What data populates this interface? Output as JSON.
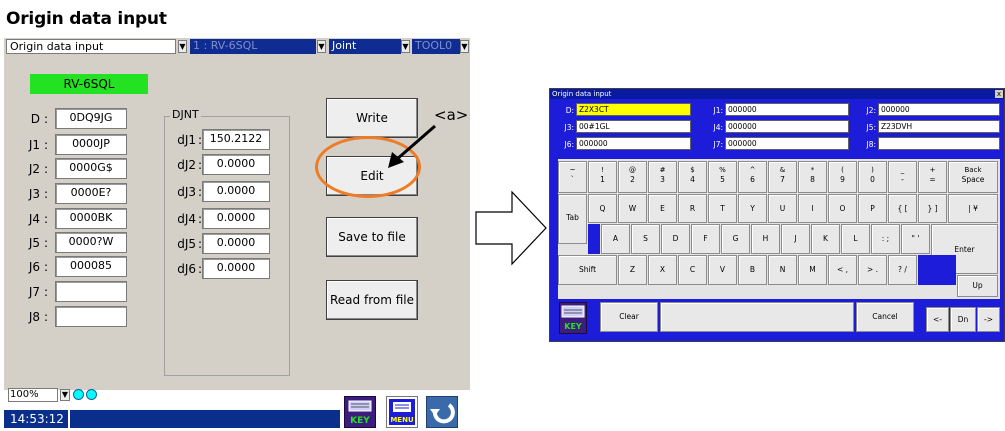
{
  "left": {
    "title": "Origin data input",
    "dropdowns": {
      "screen": "Origin data input",
      "robot": "1 : RV-6SQL",
      "joint": "Joint",
      "tool": "TOOL0"
    },
    "robot_model": "RV-6SQL",
    "axes": [
      {
        "label": "D",
        "value": "0DQ9JG"
      },
      {
        "label": "J1",
        "value": "0000JP"
      },
      {
        "label": "J2",
        "value": "0000G$"
      },
      {
        "label": "J3",
        "value": "0000E?"
      },
      {
        "label": "J4",
        "value": "0000BK"
      },
      {
        "label": "J5",
        "value": "0000?W"
      },
      {
        "label": "J6",
        "value": "000085"
      },
      {
        "label": "J7",
        "value": ""
      },
      {
        "label": "J8",
        "value": ""
      }
    ],
    "djnt": {
      "title": "DJNT",
      "rows": [
        {
          "label": "dJ1",
          "value": "150.2122"
        },
        {
          "label": "dJ2",
          "value": "0.0000"
        },
        {
          "label": "dJ3",
          "value": "0.0000"
        },
        {
          "label": "dJ4",
          "value": "0.0000"
        },
        {
          "label": "dJ5",
          "value": "0.0000"
        },
        {
          "label": "dJ6",
          "value": "0.0000"
        }
      ]
    },
    "buttons": {
      "write": "Write",
      "edit": "Edit",
      "save": "Save to file",
      "read": "Read from file"
    },
    "callout_label": "<a>",
    "zoom": "100%",
    "time": "14:53:12",
    "icons": {
      "key": "KEY",
      "menu": "MENU"
    }
  },
  "right": {
    "title": "Origin data input",
    "close_glyph": "x",
    "fields": [
      {
        "label": "D:",
        "value": "Z2X3CT"
      },
      {
        "label": "J1:",
        "value": "000000"
      },
      {
        "label": "J2:",
        "value": "000000"
      },
      {
        "label": "J3:",
        "value": "00#1GL"
      },
      {
        "label": "J4:",
        "value": "000000"
      },
      {
        "label": "J5:",
        "value": "Z23DVH"
      },
      {
        "label": "J6:",
        "value": "000000"
      },
      {
        "label": "J7:",
        "value": "000000"
      },
      {
        "label": "J8:",
        "value": ""
      }
    ],
    "keyboard": {
      "row1": [
        {
          "top": "~",
          "bot": "`"
        },
        {
          "top": "!",
          "bot": "1"
        },
        {
          "top": "@",
          "bot": "2"
        },
        {
          "top": "#",
          "bot": "3"
        },
        {
          "top": "$",
          "bot": "4"
        },
        {
          "top": "%",
          "bot": "5"
        },
        {
          "top": "^",
          "bot": "6"
        },
        {
          "top": "&",
          "bot": "7"
        },
        {
          "top": "*",
          "bot": "8"
        },
        {
          "top": "(",
          "bot": "9"
        },
        {
          "top": ")",
          "bot": "0"
        },
        {
          "top": "_",
          "bot": "-"
        },
        {
          "top": "+",
          "bot": "="
        },
        {
          "top": "Back",
          "bot": "Space"
        }
      ],
      "row2": [
        "Tab",
        "Q",
        "W",
        "E",
        "R",
        "T",
        "Y",
        "U",
        "I",
        "O",
        "P",
        "{ [",
        "} ]",
        "| ¥"
      ],
      "row3": [
        "A",
        "S",
        "D",
        "F",
        "G",
        "H",
        "J",
        "K",
        "L",
        ": ;",
        "\" '",
        "Enter"
      ],
      "row4": [
        "Shift",
        "Z",
        "X",
        "C",
        "V",
        "B",
        "N",
        "M",
        "< ,",
        "> .",
        "? /",
        "Up"
      ],
      "row5": [
        "Clear",
        "Cancel",
        "<-",
        "Dn",
        "->"
      ],
      "key_icon": "KEY"
    }
  }
}
